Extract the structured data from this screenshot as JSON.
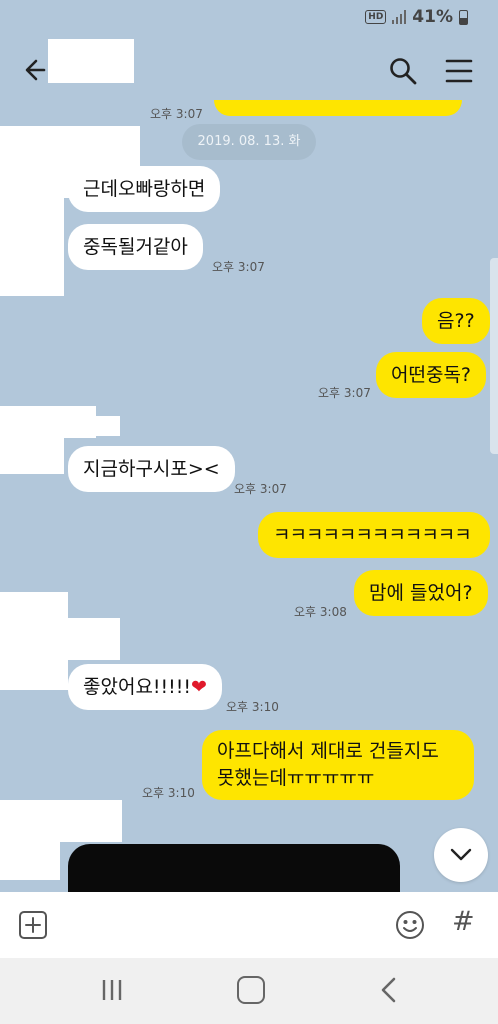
{
  "status": {
    "hd": "HD",
    "battery": "41%"
  },
  "header": {
    "back_icon": "arrow-left-icon",
    "search_icon": "search-icon",
    "menu_icon": "hamburger-menu-icon"
  },
  "chat": {
    "top_time": "오후 3:07",
    "date": "2019. 08. 13. 화",
    "messages": [
      {
        "side": "in",
        "text": "근데오빠랑하면"
      },
      {
        "side": "in",
        "text": "중독될거같아",
        "time": "오후 3:07"
      },
      {
        "side": "out",
        "text": "음??"
      },
      {
        "side": "out",
        "text": "어떤중독?",
        "time": "오후 3:07"
      },
      {
        "side": "in",
        "text": "지금하구시포><",
        "time": "오후 3:07"
      },
      {
        "side": "out",
        "text": "ㅋㅋㅋㅋㅋㅋㅋㅋㅋㅋㅋㅋ"
      },
      {
        "side": "out",
        "text": "맘에 들었어?",
        "time": "오후 3:08"
      },
      {
        "side": "in",
        "text": "좋았어요!!!!!",
        "emoji": "❤",
        "time": "오후 3:10"
      },
      {
        "side": "out",
        "text": "아프다해서 제대로 건들지도 못했는데ㅠㅠㅠㅠㅠ",
        "time": "오후 3:10"
      }
    ]
  },
  "input": {
    "hash": "#",
    "plus_icon": "plus-icon",
    "emoji_icon": "emoji-icon"
  },
  "colors": {
    "background": "#b2c7da",
    "incoming": "#ffffff",
    "outgoing": "#fee500"
  }
}
